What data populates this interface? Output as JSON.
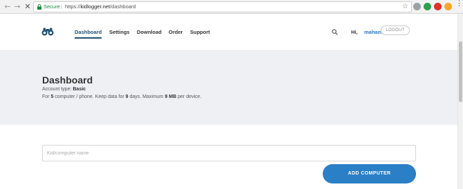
{
  "browser": {
    "back_icon": "←",
    "forward_icon": "→",
    "stop_icon": "✕",
    "secure_label": "Secure",
    "separator": "|",
    "url_scheme": "https://",
    "url_host": "kidlogger.net",
    "url_path": "/dashboard",
    "star_icon": "☆",
    "extensions": [
      "extension-icon",
      "grammarly-icon",
      "opera-icon",
      "chrome-icon"
    ],
    "menu_icon": "⋮"
  },
  "header": {
    "logo": "binoculars-icon",
    "nav": [
      {
        "label": "Dashboard",
        "active": true
      },
      {
        "label": "Settings"
      },
      {
        "label": "Download"
      },
      {
        "label": "Order"
      },
      {
        "label": "Support"
      }
    ],
    "search_icon": "search-icon",
    "greeting": "Hi,",
    "username": "maham",
    "logout_label": "LOGOUT"
  },
  "hero": {
    "title": "Dashboard",
    "account_type_label": "Account type:",
    "account_type_value": "Basic",
    "plan": {
      "p1": "For ",
      "computers": "5",
      "p2": " computer / phone. Keep data for ",
      "days": "9",
      "p3": " days. Maximum ",
      "size": "9 MB",
      "p4": " per device."
    }
  },
  "main": {
    "input_placeholder": "Kid/computer name",
    "input_value": "",
    "add_button_label": "ADD COMPUTER"
  },
  "colors": {
    "accent": "#2a7fc6",
    "nav_active": "#1e4f73",
    "secure_green": "#1a8a3c",
    "hero_bg": "#eef0f4"
  }
}
